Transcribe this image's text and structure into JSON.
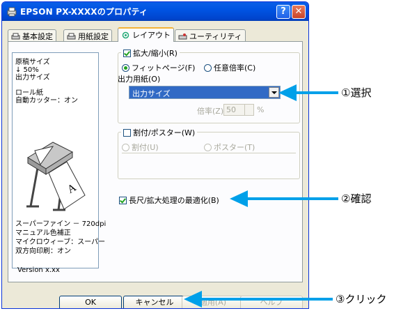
{
  "window": {
    "title": "EPSON PX-XXXXのプロパティ",
    "help_button": "?",
    "close_button": "✕"
  },
  "tabs": [
    {
      "label": "基本設定",
      "active": false
    },
    {
      "label": "用紙設定",
      "active": false
    },
    {
      "label": "レイアウト",
      "active": true
    },
    {
      "label": "ユーティリティ",
      "active": false
    }
  ],
  "preview": {
    "lines_top": [
      "原稿サイズ",
      "↓ 50%",
      "出力サイズ",
      "",
      "ロール紙",
      "自動カッター：オン"
    ],
    "lines_bottom": [
      "スーパーファイン － 720dpi",
      "マニュアル色補正",
      "マイクロウィーブ：スーパー",
      "双方向印刷：オン"
    ],
    "paper_letter": "A",
    "version": "Version x.xx"
  },
  "scale_group": {
    "checkbox_label": "拡大/縮小(R)",
    "checked": true,
    "radio_fit": "フィットページ(F)",
    "radio_custom": "任意倍率(C)",
    "selected": "fit",
    "output_paper_label": "出力用紙(O)",
    "output_paper_value": "出力サイズ",
    "ratio_label": "倍率(Z)",
    "ratio_value": "50",
    "ratio_unit": "%"
  },
  "split_group": {
    "checkbox_label": "割付/ポスター(W)",
    "checked": false,
    "radio_split": "割付(U)",
    "radio_poster": "ポスター(T)"
  },
  "optimize": {
    "label": "長尺/拡大処理の最適化(B)",
    "checked": true
  },
  "buttons": {
    "ok": "OK",
    "cancel": "キャンセル",
    "apply": "適用(A)",
    "help": "ヘルプ"
  },
  "callouts": {
    "select": "①選択",
    "confirm": "②確認",
    "click": "③クリック"
  },
  "colors": {
    "callout_arrow": "#00a0e9",
    "titlebar": "#0054e3"
  }
}
